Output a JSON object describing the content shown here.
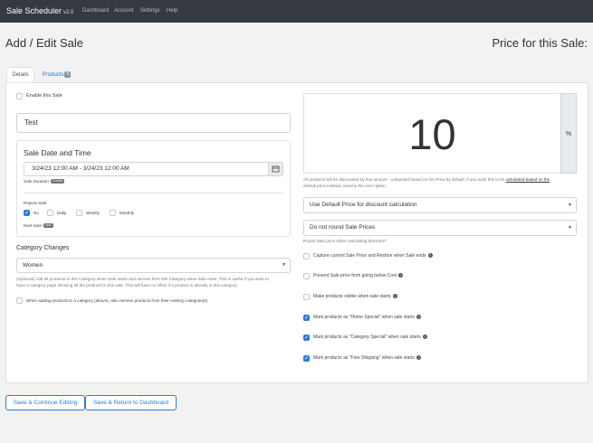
{
  "navbar": {
    "brand": "Sale Scheduler",
    "version": "v2.0",
    "links": [
      "Dashboard",
      "Account",
      "Settings",
      "Help"
    ]
  },
  "page": {
    "title": "Add / Edit Sale",
    "price_title": "Price for this Sale:"
  },
  "tabs": {
    "details": "Details",
    "products": "Products",
    "products_count": "0"
  },
  "details": {
    "enable_label": "Enable this Sale",
    "sale_name": "Test",
    "date_heading": "Sale Date and Time",
    "date_range": "3/24/23 12:00 AM - 3/24/23 12:00 AM",
    "duration_label": "Sale Duration:",
    "duration_badge": "0 mins",
    "repeat_label": "Repeat Sale:",
    "repeat_options": [
      "No",
      "Daily",
      "Weekly",
      "Monthly"
    ],
    "next_sale_label": "Next Sale:",
    "next_sale_badge": "N/A",
    "category_heading": "Category Changes",
    "category_value": "Women",
    "category_help_1": "(Optional) Add all products to this Category when Sale starts and remove from this Category when Sale ends. This is useful if you want to",
    "category_help_2": "have a category page showing all the products in this sale. This will have no effect if a product is already in this category.",
    "remove_categories_label": "When adding products to a category (above), also remove products from their existing categorie(s)"
  },
  "price": {
    "value": "10",
    "unit": "%",
    "help_prefix": "All products will be discounted by this amount - computed based on the Price by default. If you want this to be ",
    "help_link": "calculated based on the",
    "help_line2": "default price instead, rename the next option.",
    "calc_select": "Use Default Price for discount calculation",
    "round_select": "Do not round Sale Prices",
    "round_help": "Round Sale price when calculating discount?"
  },
  "options": [
    {
      "label": "Capture current Sale Price and Restore when Sale ends",
      "checked": false
    },
    {
      "label": "Prevent Sale price from going below Cost",
      "checked": false
    },
    {
      "label": "Make products visible when sale starts",
      "checked": false
    },
    {
      "label": "Mark products as \"Home Special\" when sale starts",
      "checked": true
    },
    {
      "label": "Mark products as \"Category Special\" when sale starts",
      "checked": true
    },
    {
      "label": "Mark products as \"Free Shipping\" when sale starts",
      "checked": true
    }
  ],
  "buttons": {
    "save_continue": "Save & Continue Editing",
    "save_return": "Save & Return to Dashboard"
  },
  "colors": {
    "navbar": "#343a40",
    "accent": "#2e7bd6"
  }
}
